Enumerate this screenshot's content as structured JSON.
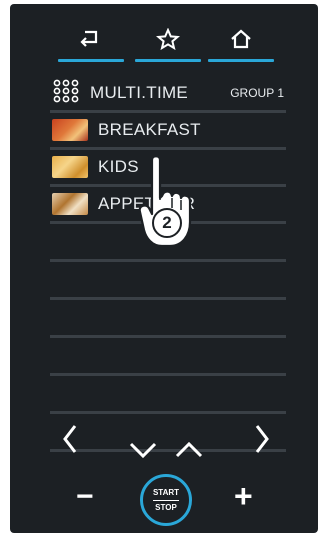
{
  "nav": {
    "back_icon": "back-arrow-icon",
    "favorite_icon": "star-icon",
    "home_icon": "home-icon"
  },
  "list": {
    "header_label": "MULTI.TIME",
    "header_group": "GROUP 1",
    "items": [
      {
        "label": "BREAKFAST",
        "image": "breakfast-thumbnail"
      },
      {
        "label": "KIDS",
        "image": "kids-thumbnail"
      },
      {
        "label": "APPETIZER",
        "image": "appetizer-thumbnail"
      }
    ]
  },
  "callout": {
    "step_number": "2"
  },
  "controls": {
    "minus_label": "−",
    "plus_label": "+",
    "start_label": "START",
    "stop_label": "STOP"
  },
  "colors": {
    "accent": "#2aa7d8",
    "panel": "#1c2024",
    "divider": "#3a4046",
    "text": "#e8ecef"
  }
}
